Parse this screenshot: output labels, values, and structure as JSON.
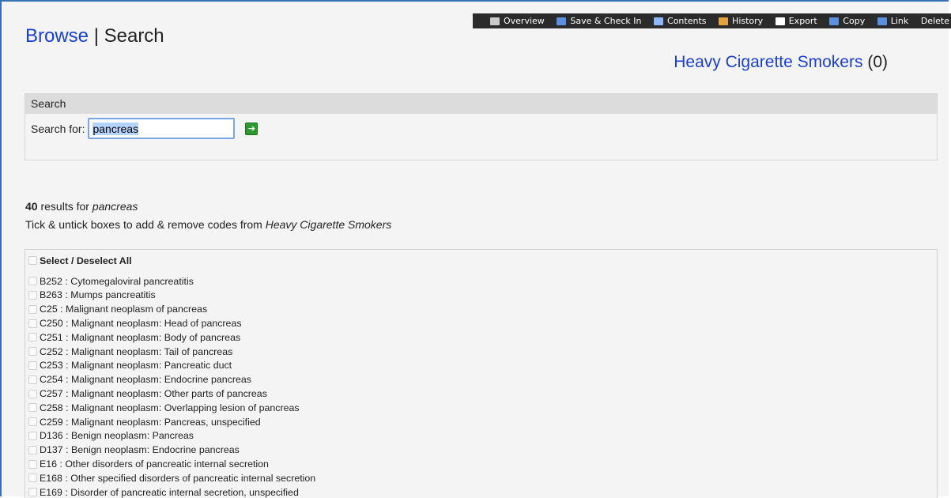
{
  "toolbar": {
    "items": [
      {
        "label": "Overview",
        "icon": "home-icon",
        "color": "#c9c9c9"
      },
      {
        "label": "Save & Check In",
        "icon": "save-icon",
        "color": "#5b8fe0"
      },
      {
        "label": "Contents",
        "icon": "search-icon",
        "color": "#8fb7ff"
      },
      {
        "label": "History",
        "icon": "history-icon",
        "color": "#e2a33c"
      },
      {
        "label": "Export",
        "icon": "export-icon",
        "color": "#ffffff"
      },
      {
        "label": "Copy",
        "icon": "copy-icon",
        "color": "#5b8fe0"
      },
      {
        "label": "Link",
        "icon": "link-icon",
        "color": "#5b8fe0"
      },
      {
        "label": "Delete",
        "icon": "",
        "color": ""
      }
    ]
  },
  "header": {
    "browse_label": "Browse",
    "separator": " | ",
    "search_label": "Search",
    "codelist_name": "Heavy Cigarette Smokers",
    "codelist_count": "(0)"
  },
  "search": {
    "panel_title": "Search",
    "label": "Search for:",
    "value": "pancreas",
    "go_icon": "arrow-right-icon"
  },
  "results": {
    "count": "40",
    "count_text": " results for ",
    "query": "pancreas",
    "hint_prefix": "Tick & untick boxes to add & remove codes from ",
    "hint_list": "Heavy Cigarette Smokers"
  },
  "list": {
    "select_all_label": "Select / Deselect All",
    "items": [
      "B252 : Cytomegaloviral pancreatitis",
      "B263 : Mumps pancreatitis",
      "C25 : Malignant neoplasm of pancreas",
      "C250 : Malignant neoplasm: Head of pancreas",
      "C251 : Malignant neoplasm: Body of pancreas",
      "C252 : Malignant neoplasm: Tail of pancreas",
      "C253 : Malignant neoplasm: Pancreatic duct",
      "C254 : Malignant neoplasm: Endocrine pancreas",
      "C257 : Malignant neoplasm: Other parts of pancreas",
      "C258 : Malignant neoplasm: Overlapping lesion of pancreas",
      "C259 : Malignant neoplasm: Pancreas, unspecified",
      "D136 : Benign neoplasm: Pancreas",
      "D137 : Benign neoplasm: Endocrine pancreas",
      "E16 : Other disorders of pancreatic internal secretion",
      "E168 : Other specified disorders of pancreatic internal secretion",
      "E169 : Disorder of pancreatic internal secretion, unspecified"
    ]
  }
}
